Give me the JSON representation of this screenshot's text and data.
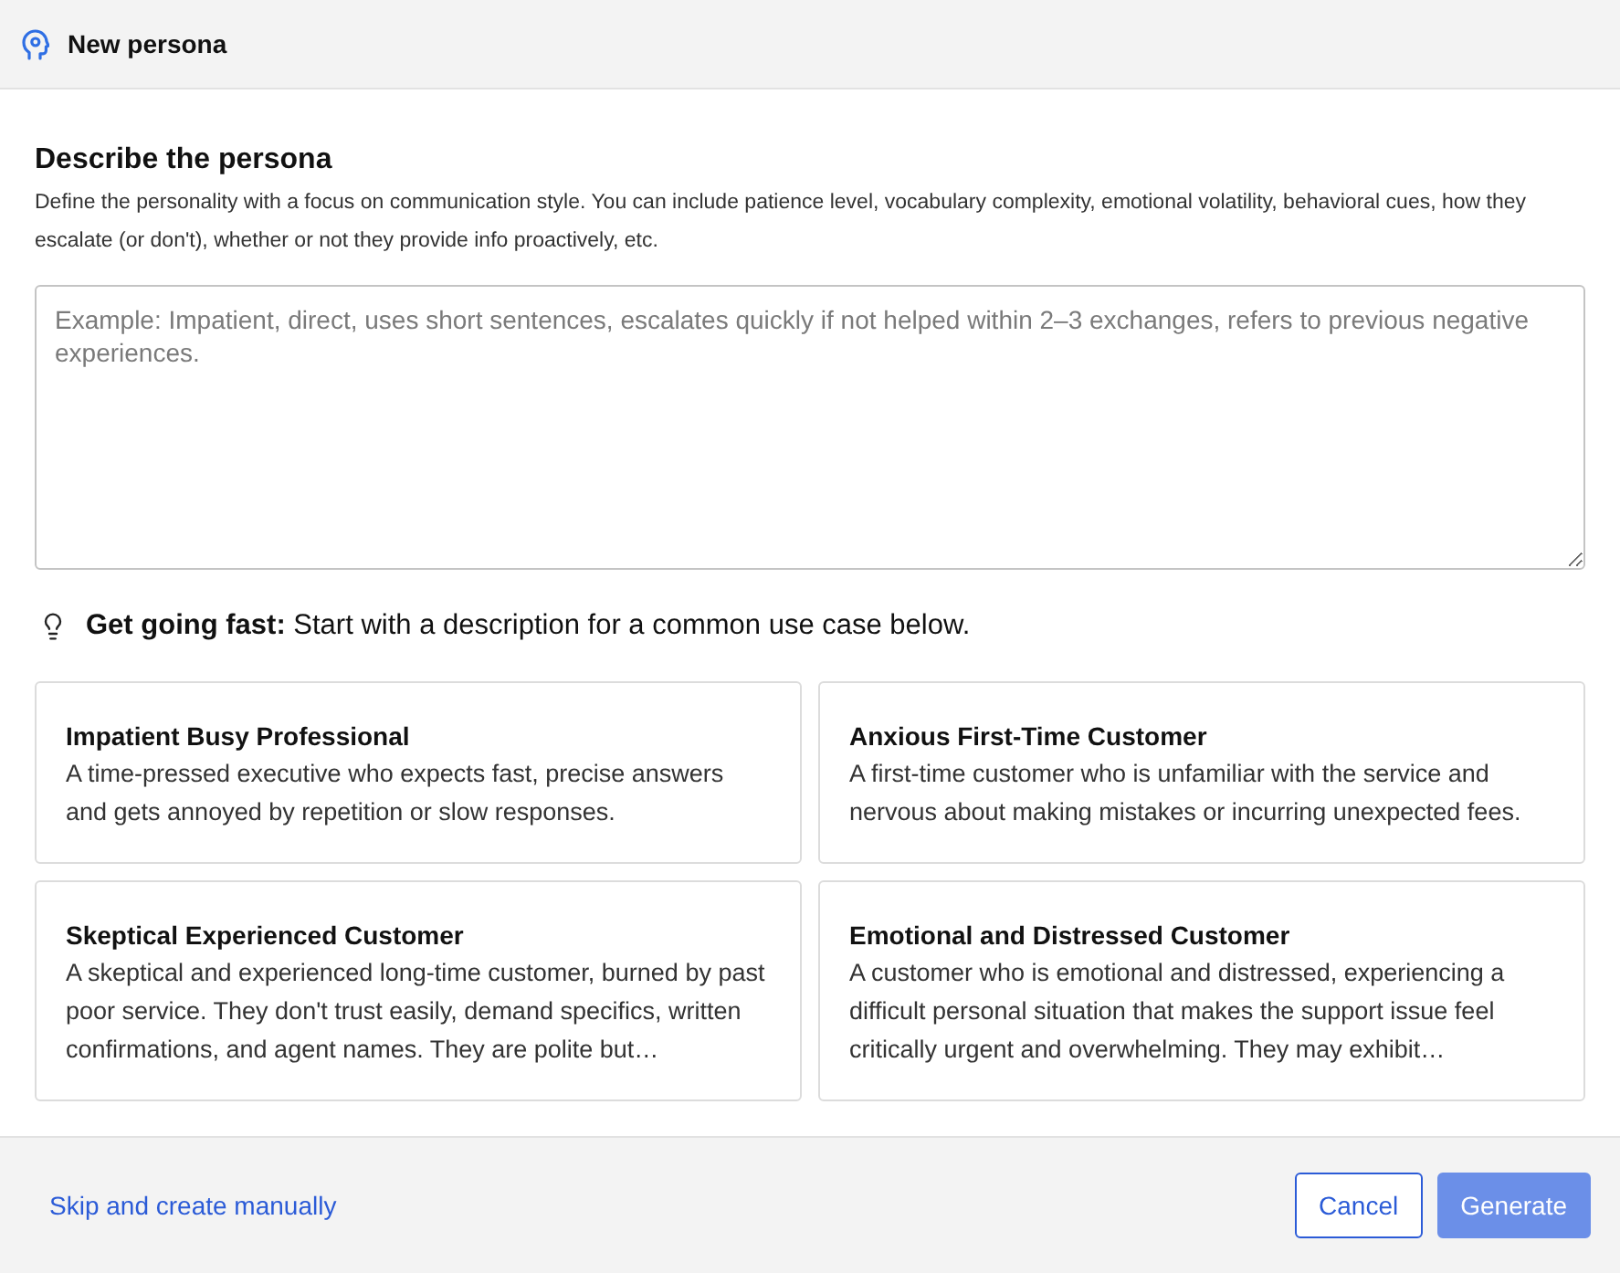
{
  "dialog": {
    "title": "New persona"
  },
  "describe": {
    "heading": "Describe the persona",
    "description": "Define the personality with a focus on communication style. You can include patience level, vocabulary complexity, emotional volatility, behavioral cues, how they escalate (or don't), whether or not they provide info proactively, etc.",
    "textarea": {
      "placeholder": "Example: Impatient, direct, uses short sentences, escalates quickly if not helped within 2–3 exchanges, refers to previous negative experiences."
    }
  },
  "tip": {
    "text": "**Get going fast:** Start with a description for a common use case below."
  },
  "templates": [
    {
      "title": "Impatient Busy Professional",
      "description": "A time-pressed executive who expects fast, precise answers and gets annoyed by repetition or slow responses."
    },
    {
      "title": "Anxious First-Time Customer",
      "description": "A first-time customer who is unfamiliar with the service and nervous about making mistakes or incurring unexpected fees."
    },
    {
      "title": "Skeptical Experienced Customer",
      "description": "A skeptical and experienced long-time customer, burned by past poor service. They don't trust easily, demand specifics, written confirmations, and agent names. They are polite but…"
    },
    {
      "title": "Emotional and Distressed Customer",
      "description": "A customer who is emotional and distressed, experiencing a difficult personal situation that makes the support issue feel critically urgent and overwhelming. They may exhibit…"
    }
  ],
  "footer": {
    "skip_link": "Skip and create manually",
    "buttons": [
      {
        "label": "Cancel",
        "kind": "secondary",
        "disabled": false
      },
      {
        "label": "Generate",
        "kind": "primary",
        "disabled": true
      }
    ]
  }
}
